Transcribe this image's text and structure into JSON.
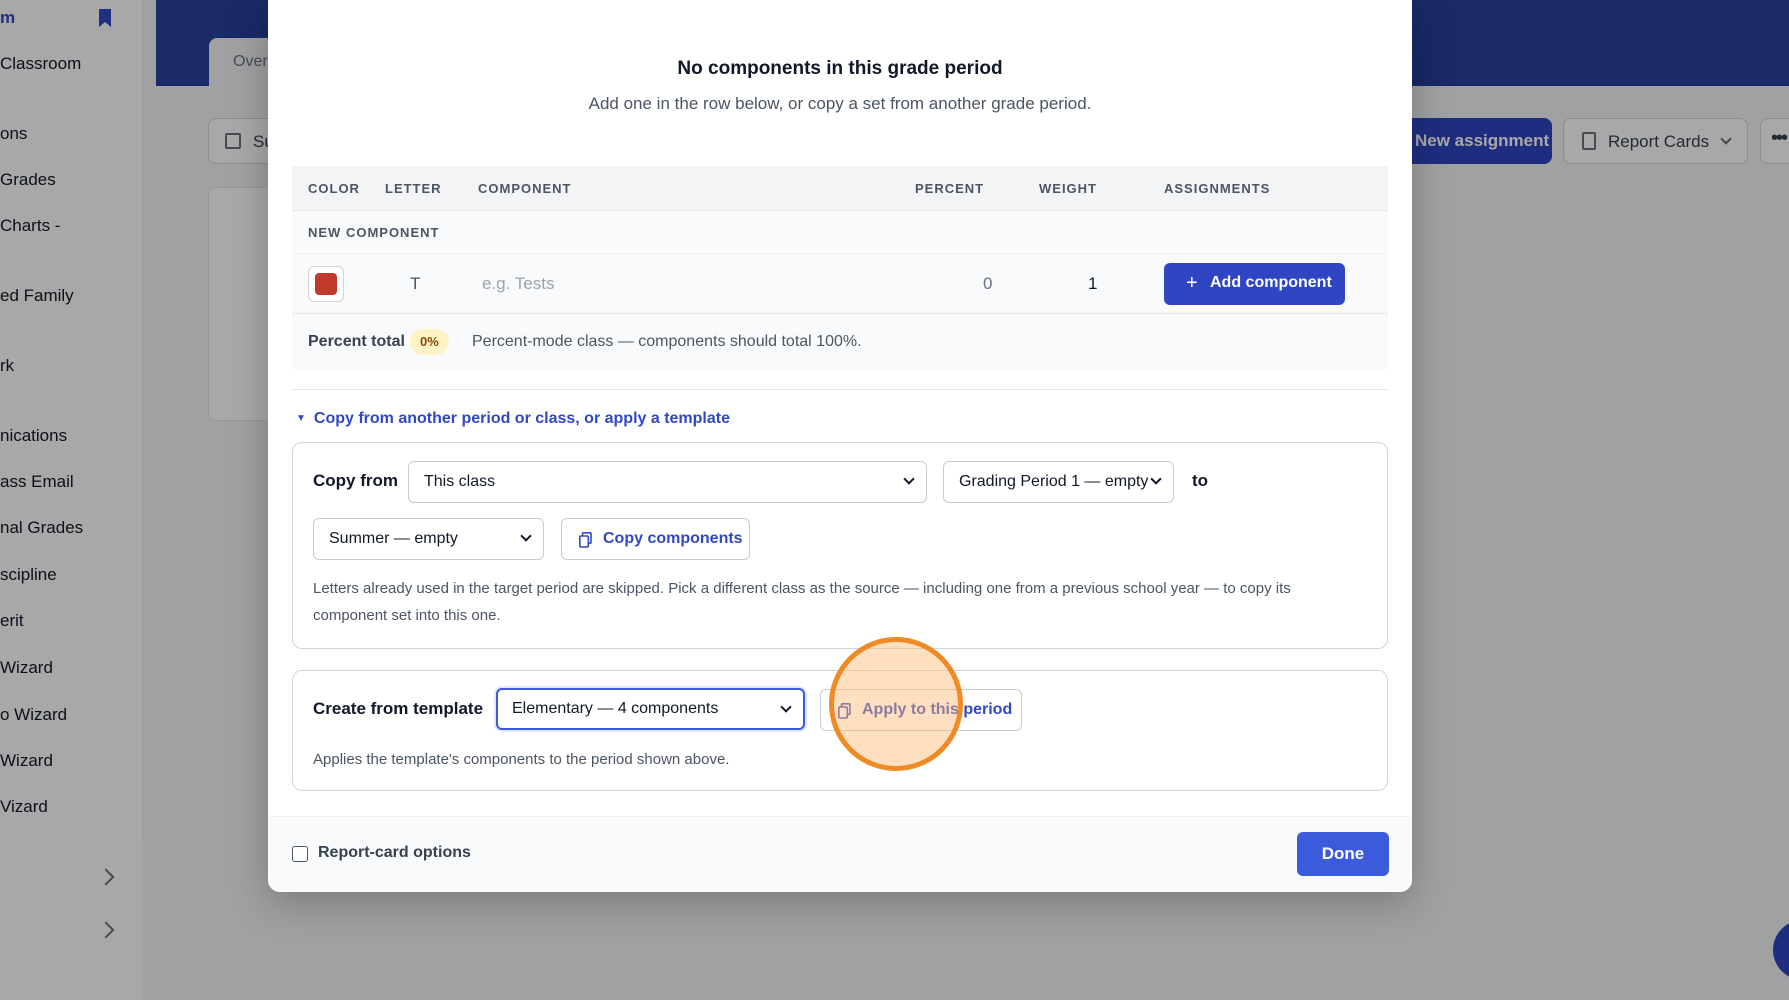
{
  "sidebar": {
    "items": [
      {
        "label": "m",
        "active": true
      },
      {
        "label": "Classroom"
      },
      {
        "label": "ons"
      },
      {
        "label": "Grades"
      },
      {
        "label": "Charts -"
      },
      {
        "label": "ed Family"
      },
      {
        "label": "rk"
      },
      {
        "label": "nications"
      },
      {
        "label": "ass Email"
      },
      {
        "label": "nal Grades"
      },
      {
        "label": "scipline"
      },
      {
        "label": "erit"
      },
      {
        "label": "Wizard"
      },
      {
        "label": "o Wizard"
      },
      {
        "label": " Wizard"
      },
      {
        "label": "Vizard"
      }
    ]
  },
  "background": {
    "tab_label": "Over",
    "toolbar_btn_label": "Su",
    "new_assignment_label": "New assignment",
    "report_cards_label": "Report Cards",
    "more_label": "•••"
  },
  "modal": {
    "title": "No components in this grade period",
    "subtitle": "Add one in the row below, or copy a set from another grade period.",
    "table": {
      "headers": {
        "color": "COLOR",
        "letter": "LETTER",
        "component": "COMPONENT",
        "percent": "PERCENT",
        "weight": "WEIGHT",
        "assignments": "ASSIGNMENTS"
      },
      "new_component_label": "NEW COMPONENT",
      "new_row": {
        "color": "#c0392b",
        "letter": "T",
        "component_placeholder": "e.g. Tests",
        "percent": "0",
        "weight": "1",
        "add_label": "Add component"
      },
      "total": {
        "label": "Percent total",
        "value": "0%",
        "note": "Percent-mode class — components should total 100%."
      }
    },
    "copy_section": {
      "toggle_label": "Copy from another period or class, or apply a template",
      "copy_from_label": "Copy from",
      "source_class": "This class",
      "source_period": "Grading Period 1 — empty",
      "to_label": "to",
      "target_period": "Summer — empty",
      "copy_button": "Copy components",
      "help": "Letters already used in the target period are skipped. Pick a different class as the source — including one from a previous school year — to copy its component set into this one."
    },
    "template_section": {
      "label": "Create from template",
      "template": "Elementary — 4 components",
      "apply_button": "Apply to this period",
      "help": "Applies the template's components to the period shown above."
    },
    "footer": {
      "report_card_options": "Report-card options",
      "done": "Done"
    }
  },
  "colors": {
    "accent": "#2f45c2",
    "topbar": "#283f9e",
    "click_ring": "#f08a24"
  }
}
